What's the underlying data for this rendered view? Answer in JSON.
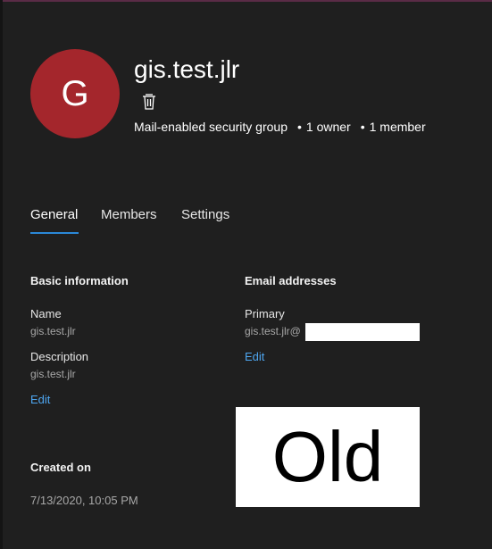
{
  "header": {
    "avatar_initial": "G",
    "avatar_color": "#a4262c",
    "group_name": "gis.test.jlr",
    "delete_icon": "trash-icon",
    "group_type": "Mail-enabled security group",
    "owners": "1 owner",
    "members": "1 member"
  },
  "tabs": [
    {
      "label": "General",
      "active": true
    },
    {
      "label": "Members",
      "active": false
    },
    {
      "label": "Settings",
      "active": false
    }
  ],
  "basic_info": {
    "title": "Basic information",
    "name_label": "Name",
    "name_value": "gis.test.jlr",
    "description_label": "Description",
    "description_value": "gis.test.jlr",
    "edit_label": "Edit"
  },
  "email": {
    "title": "Email addresses",
    "primary_label": "Primary",
    "primary_value": "gis.test.jlr@",
    "edit_label": "Edit"
  },
  "created": {
    "label": "Created on",
    "value": "7/13/2020, 10:05 PM"
  },
  "overlay_text": "Old",
  "colors": {
    "accent": "#2b88d8",
    "link": "#4ea6f0",
    "background": "#1f1f1f"
  }
}
